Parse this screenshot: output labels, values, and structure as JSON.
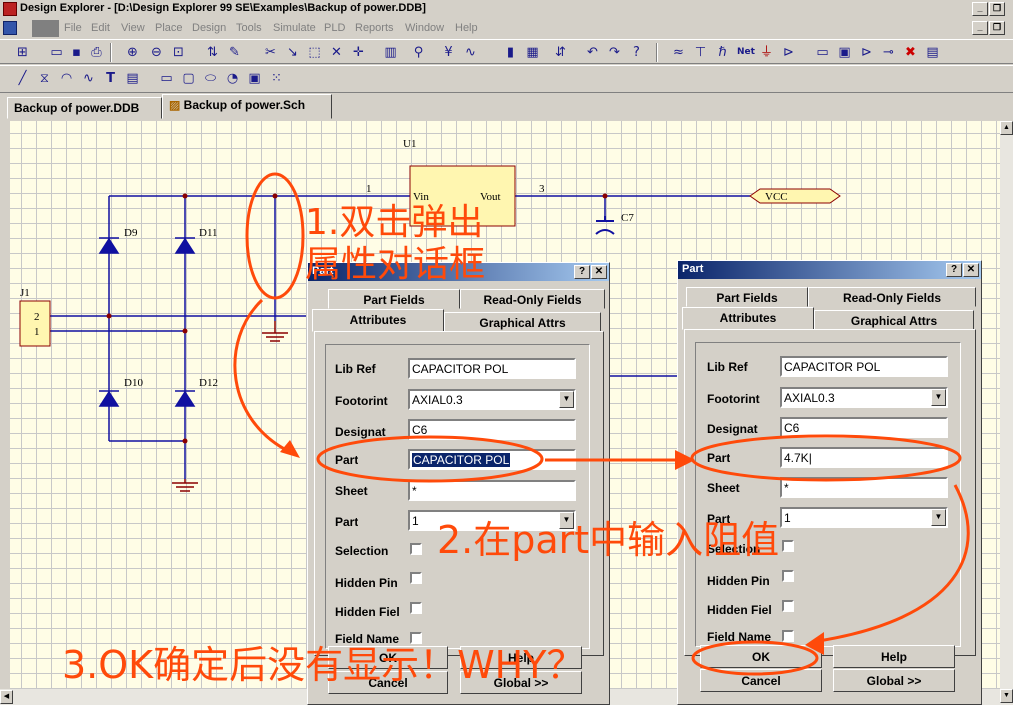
{
  "window": {
    "title": "Design Explorer - [D:\\Design Explorer 99 SE\\Examples\\Backup of power.DDB]"
  },
  "menu": [
    "File",
    "Edit",
    "View",
    "Place",
    "Design",
    "Tools",
    "Simulate",
    "PLD",
    "Reports",
    "Window",
    "Help"
  ],
  "tabs": [
    "Backup of power.DDB",
    "Backup of power.Sch"
  ],
  "schematic": {
    "u1": "U1",
    "vin": "Vin",
    "vout": "Vout",
    "pin1": "1",
    "pin3": "3",
    "vcc": "VCC",
    "c7": "C7",
    "d9": "D9",
    "d11": "D11",
    "d10": "D10",
    "d12": "D12",
    "j1": "J1",
    "j1_pin2": "2",
    "j1_pin1": "1"
  },
  "dialog_left": {
    "title": "Part",
    "tabs": [
      "Part Fields",
      "Read-Only Fields",
      "Attributes",
      "Graphical Attrs"
    ],
    "labels": {
      "lib_ref": "Lib Ref",
      "footprint": "Footorint",
      "designator": "Designat",
      "part": "Part",
      "sheet": "Sheet",
      "part_num": "Part",
      "selection": "Selection",
      "hidden_pins": "Hidden Pin",
      "hidden_fields": "Hidden Fiel",
      "field_names": "Field Name"
    },
    "values": {
      "lib_ref": "CAPACITOR POL",
      "footprint": "AXIAL0.3",
      "designator": "C6",
      "part": "CAPACITOR POL",
      "sheet": "*",
      "part_num": "1"
    },
    "buttons": {
      "ok": "OK",
      "help": "Help",
      "cancel": "Cancel",
      "global": "Global >>"
    }
  },
  "dialog_right": {
    "title": "Part",
    "tabs": [
      "Part Fields",
      "Read-Only Fields",
      "Attributes",
      "Graphical Attrs"
    ],
    "labels": {
      "lib_ref": "Lib Ref",
      "footprint": "Footorint",
      "designator": "Designat",
      "part": "Part",
      "sheet": "Sheet",
      "part_num": "Part",
      "selection": "Selection",
      "hidden_pins": "Hidden Pin",
      "hidden_fields": "Hidden Fiel",
      "field_names": "Field Name"
    },
    "values": {
      "lib_ref": "CAPACITOR POL",
      "footprint": "AXIAL0.3",
      "designator": "C6",
      "part": "4.7K",
      "sheet": "*",
      "part_num": "1"
    },
    "buttons": {
      "ok": "OK",
      "help": "Help",
      "cancel": "Cancel",
      "global": "Global >>"
    }
  },
  "annotations": {
    "step1_line1": "1.双击弹出",
    "step1_line2": "属性对话框",
    "step2": "2.在part中输入阻值",
    "step3": "3.OK确定后没有显示！WHY？"
  },
  "colors": {
    "annotation": "#ff4a0a",
    "wire": "#1010a0",
    "component_fill": "#fff6b0",
    "title_bar": "#0a246a",
    "selection": "#0a246a"
  }
}
